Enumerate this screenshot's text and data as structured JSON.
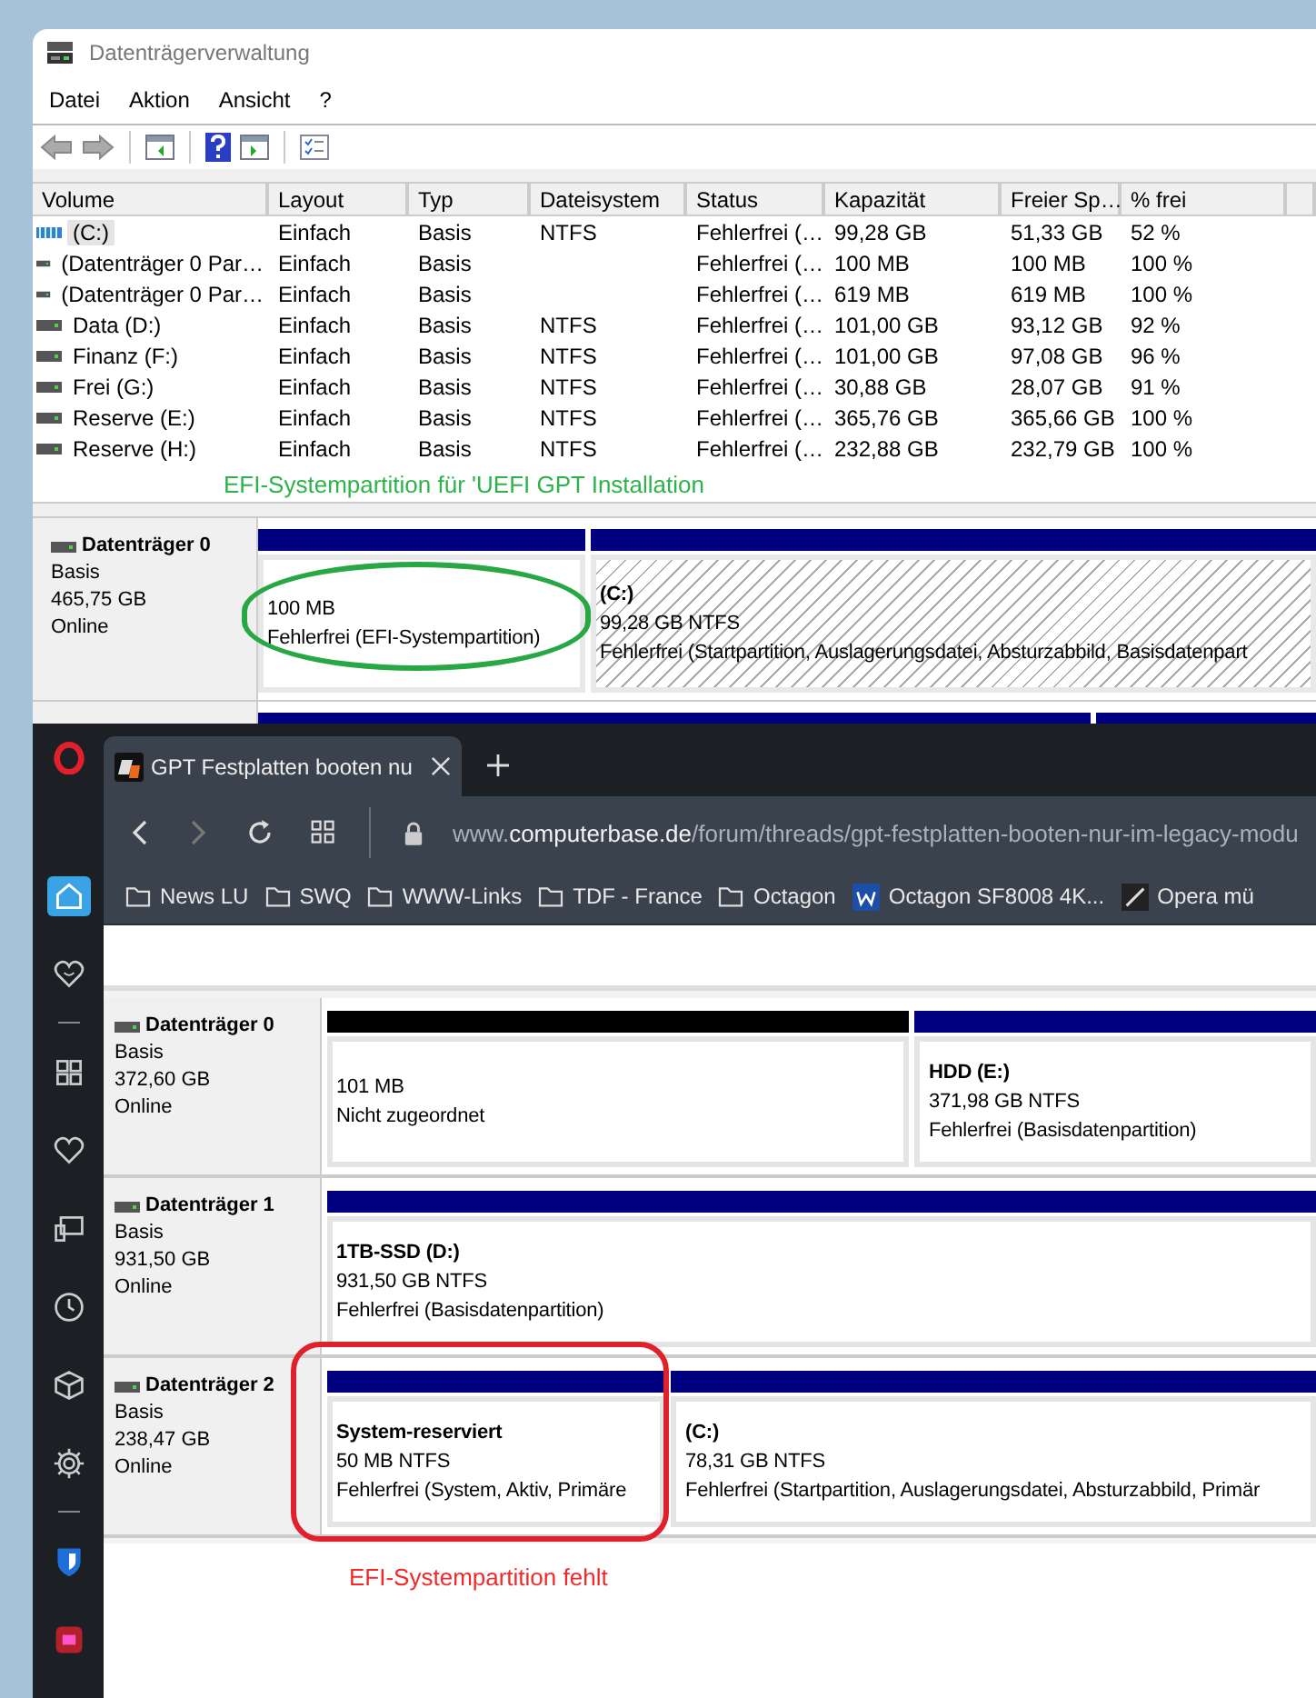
{
  "disk_management": {
    "title": "Datenträgerverwaltung",
    "menu": [
      "Datei",
      "Aktion",
      "Ansicht",
      "?"
    ],
    "table": {
      "columns": [
        "Volume",
        "Layout",
        "Typ",
        "Dateisystem",
        "Status",
        "Kapazität",
        "Freier Sp…",
        "% frei"
      ],
      "rows": [
        {
          "kind": "boot",
          "selected": true,
          "cells": [
            "(C:)",
            "Einfach",
            "Basis",
            "NTFS",
            "Fehlerfrei (…",
            "99,28 GB",
            "51,33 GB",
            "52 %"
          ]
        },
        {
          "kind": "data",
          "selected": false,
          "cells": [
            "(Datenträger 0 Par…",
            "Einfach",
            "Basis",
            "",
            "Fehlerfrei (…",
            "100 MB",
            "100 MB",
            "100 %"
          ]
        },
        {
          "kind": "data",
          "selected": false,
          "cells": [
            "(Datenträger 0 Par…",
            "Einfach",
            "Basis",
            "",
            "Fehlerfrei (…",
            "619 MB",
            "619 MB",
            "100 %"
          ]
        },
        {
          "kind": "data",
          "selected": false,
          "cells": [
            "Data (D:)",
            "Einfach",
            "Basis",
            "NTFS",
            "Fehlerfrei (…",
            "101,00 GB",
            "93,12 GB",
            "92 %"
          ]
        },
        {
          "kind": "data",
          "selected": false,
          "cells": [
            "Finanz (F:)",
            "Einfach",
            "Basis",
            "NTFS",
            "Fehlerfrei (…",
            "101,00 GB",
            "97,08 GB",
            "96 %"
          ]
        },
        {
          "kind": "data",
          "selected": false,
          "cells": [
            "Frei (G:)",
            "Einfach",
            "Basis",
            "NTFS",
            "Fehlerfrei (…",
            "30,88 GB",
            "28,07 GB",
            "91 %"
          ]
        },
        {
          "kind": "data",
          "selected": false,
          "cells": [
            "Reserve (E:)",
            "Einfach",
            "Basis",
            "NTFS",
            "Fehlerfrei (…",
            "365,76 GB",
            "365,66 GB",
            "100 %"
          ]
        },
        {
          "kind": "data",
          "selected": false,
          "cells": [
            "Reserve (H:)",
            "Einfach",
            "Basis",
            "NTFS",
            "Fehlerfrei (…",
            "232,88 GB",
            "232,79 GB",
            "100 %"
          ]
        }
      ]
    },
    "disks": [
      {
        "name": "Datenträger 0",
        "type": "Basis",
        "size": "465,75 GB",
        "status": "Online",
        "partitions": [
          {
            "kind": "primary",
            "selected": false,
            "size": "100 MB",
            "status": "Fehlerfrei (EFI-Systempartition)"
          },
          {
            "kind": "primary",
            "selected": true,
            "name": "(C:)",
            "size": "99,28 GB NTFS",
            "status": "Fehlerfrei (Startpartition, Auslagerungsdatei, Absturzabbild, Basisdatenpart"
          }
        ]
      },
      {
        "partitions": [
          {
            "kind": "primary"
          },
          {
            "kind": "primary"
          }
        ]
      }
    ],
    "note": "EFI-Systempartition für 'UEFI GPT Installation"
  },
  "browser": {
    "sidebar": [
      {
        "kind": "home",
        "selected": true
      },
      {
        "kind": "messenger",
        "selected": false
      },
      {
        "kind": "separator"
      },
      {
        "kind": "grid",
        "selected": false
      },
      {
        "kind": "heart",
        "selected": false
      },
      {
        "kind": "monitor",
        "selected": false
      },
      {
        "kind": "clock",
        "selected": false
      },
      {
        "kind": "cube",
        "selected": false
      },
      {
        "kind": "gear",
        "selected": false
      },
      {
        "kind": "separator"
      },
      {
        "kind": "shield",
        "selected": false
      },
      {
        "kind": "extension",
        "selected": false
      }
    ],
    "tab": {
      "title": "GPT Festplatten booten nu",
      "selected": true
    },
    "address": {
      "prefix": "www.",
      "domain": "computerbase.de",
      "path": "/forum/threads/gpt-festplatten-booten-nur-im-legacy-modu"
    },
    "bookmarks": [
      {
        "kind": "folder",
        "label": "News LU"
      },
      {
        "kind": "folder",
        "label": "SWQ"
      },
      {
        "kind": "folder",
        "label": "WWW-Links"
      },
      {
        "kind": "folder",
        "label": "TDF - France"
      },
      {
        "kind": "folder",
        "label": "Octagon"
      },
      {
        "kind": "site",
        "label": "Octagon SF8008 4K..."
      },
      {
        "kind": "pen",
        "label": "Opera mü"
      }
    ],
    "page": {
      "disks": [
        {
          "name": "Datenträger 0",
          "type": "Basis",
          "size": "372,60 GB",
          "status": "Online",
          "partitions": [
            {
              "kind": "unallocated",
              "selected": false,
              "size": "101 MB",
              "status": "Nicht zugeordnet"
            },
            {
              "kind": "primary",
              "selected": false,
              "name": "HDD  (E:)",
              "size": "371,98 GB NTFS",
              "status": "Fehlerfrei (Basisdatenpartition)"
            }
          ]
        },
        {
          "name": "Datenträger 1",
          "type": "Basis",
          "size": "931,50 GB",
          "status": "Online",
          "partitions": [
            {
              "kind": "primary",
              "selected": false,
              "name": "1TB-SSD  (D:)",
              "size": "931,50 GB NTFS",
              "status": "Fehlerfrei (Basisdatenpartition)"
            }
          ]
        },
        {
          "name": "Datenträger 2",
          "type": "Basis",
          "size": "238,47 GB",
          "status": "Online",
          "partitions": [
            {
              "kind": "primary",
              "selected": false,
              "name": "System-reserviert",
              "size": "50 MB NTFS",
              "status": "Fehlerfrei (System, Aktiv, Primäre"
            },
            {
              "kind": "primary",
              "selected": false,
              "name": "(C:)",
              "size": "78,31 GB NTFS",
              "status": "Fehlerfrei (Startpartition, Auslagerungsdatei, Absturzabbild, Primär"
            }
          ]
        }
      ],
      "note": "EFI-Systempartition fehlt"
    }
  }
}
